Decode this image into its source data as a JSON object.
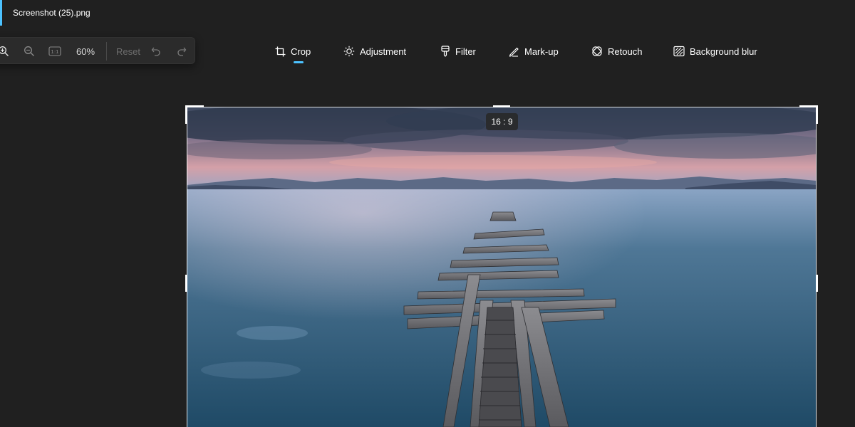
{
  "window": {
    "title": "Screenshot (25).png"
  },
  "zoom_toolbar": {
    "zoom_in_icon": "zoom-in-icon",
    "zoom_out_icon": "zoom-out-icon",
    "actual_size_icon": "actual-size-icon",
    "actual_size_glyph": "1:1",
    "zoom_level": "60%",
    "reset_label": "Reset",
    "undo_icon": "undo-icon",
    "redo_icon": "redo-icon"
  },
  "tools": [
    {
      "label": "Crop",
      "icon": "crop-icon",
      "active": true
    },
    {
      "label": "Adjustment",
      "icon": "brightness-icon",
      "active": false
    },
    {
      "label": "Filter",
      "icon": "filter-icon",
      "active": false
    },
    {
      "label": "Mark-up",
      "icon": "pen-icon",
      "active": false
    },
    {
      "label": "Retouch",
      "icon": "retouch-icon",
      "active": false
    },
    {
      "label": "Background blur",
      "icon": "background-blur-icon",
      "active": false
    }
  ],
  "crop": {
    "aspect_ratio": "16 : 9"
  },
  "colors": {
    "accent": "#4cc2ff",
    "background": "#202020",
    "toolbar": "#2b2b2b"
  }
}
